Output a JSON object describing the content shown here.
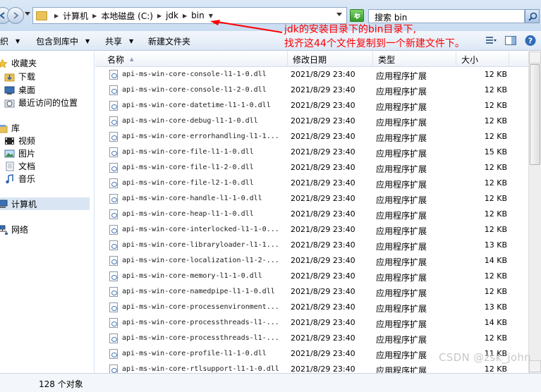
{
  "address_bar": {
    "breadcrumbs": [
      "计算机",
      "本地磁盘 (C:)",
      "jdk",
      "bin"
    ],
    "search_value": "搜索 bin"
  },
  "toolbar": {
    "items": [
      "组织",
      "包含到库中",
      "共享",
      "新建文件夹"
    ]
  },
  "nav": {
    "favorites": "收藏夹",
    "downloads": "下载",
    "desktop": "桌面",
    "recent": "最近访问的位置",
    "libraries": "库",
    "videos": "视频",
    "pictures": "图片",
    "documents": "文档",
    "music": "音乐",
    "computer": "计算机",
    "network": "网络"
  },
  "columns": {
    "name": "名称",
    "date": "修改日期",
    "type": "类型",
    "size": "大小"
  },
  "files": [
    {
      "name": "api-ms-win-core-console-l1-1-0.dll",
      "date": "2021/8/29 23:40",
      "type": "应用程序扩展",
      "size": "12 KB"
    },
    {
      "name": "api-ms-win-core-console-l1-2-0.dll",
      "date": "2021/8/29 23:40",
      "type": "应用程序扩展",
      "size": "12 KB"
    },
    {
      "name": "api-ms-win-core-datetime-l1-1-0.dll",
      "date": "2021/8/29 23:40",
      "type": "应用程序扩展",
      "size": "12 KB"
    },
    {
      "name": "api-ms-win-core-debug-l1-1-0.dll",
      "date": "2021/8/29 23:40",
      "type": "应用程序扩展",
      "size": "12 KB"
    },
    {
      "name": "api-ms-win-core-errorhandling-l1-1...",
      "date": "2021/8/29 23:40",
      "type": "应用程序扩展",
      "size": "12 KB"
    },
    {
      "name": "api-ms-win-core-file-l1-1-0.dll",
      "date": "2021/8/29 23:40",
      "type": "应用程序扩展",
      "size": "15 KB"
    },
    {
      "name": "api-ms-win-core-file-l1-2-0.dll",
      "date": "2021/8/29 23:40",
      "type": "应用程序扩展",
      "size": "12 KB"
    },
    {
      "name": "api-ms-win-core-file-l2-1-0.dll",
      "date": "2021/8/29 23:40",
      "type": "应用程序扩展",
      "size": "12 KB"
    },
    {
      "name": "api-ms-win-core-handle-l1-1-0.dll",
      "date": "2021/8/29 23:40",
      "type": "应用程序扩展",
      "size": "12 KB"
    },
    {
      "name": "api-ms-win-core-heap-l1-1-0.dll",
      "date": "2021/8/29 23:40",
      "type": "应用程序扩展",
      "size": "12 KB"
    },
    {
      "name": "api-ms-win-core-interlocked-l1-1-0...",
      "date": "2021/8/29 23:40",
      "type": "应用程序扩展",
      "size": "12 KB"
    },
    {
      "name": "api-ms-win-core-libraryloader-l1-1...",
      "date": "2021/8/29 23:40",
      "type": "应用程序扩展",
      "size": "13 KB"
    },
    {
      "name": "api-ms-win-core-localization-l1-2-...",
      "date": "2021/8/29 23:40",
      "type": "应用程序扩展",
      "size": "14 KB"
    },
    {
      "name": "api-ms-win-core-memory-l1-1-0.dll",
      "date": "2021/8/29 23:40",
      "type": "应用程序扩展",
      "size": "12 KB"
    },
    {
      "name": "api-ms-win-core-namedpipe-l1-1-0.dll",
      "date": "2021/8/29 23:40",
      "type": "应用程序扩展",
      "size": "12 KB"
    },
    {
      "name": "api-ms-win-core-processenvironment...",
      "date": "2021/8/29 23:40",
      "type": "应用程序扩展",
      "size": "13 KB"
    },
    {
      "name": "api-ms-win-core-processthreads-l1-...",
      "date": "2021/8/29 23:40",
      "type": "应用程序扩展",
      "size": "14 KB"
    },
    {
      "name": "api-ms-win-core-processthreads-l1-...",
      "date": "2021/8/29 23:40",
      "type": "应用程序扩展",
      "size": "12 KB"
    },
    {
      "name": "api-ms-win-core-profile-l1-1-0.dll",
      "date": "2021/8/29 23:40",
      "type": "应用程序扩展",
      "size": "11 KB"
    },
    {
      "name": "api-ms-win-core-rtlsupport-l1-1-0.dll",
      "date": "2021/8/29 23:40",
      "type": "应用程序扩展",
      "size": "12 KB"
    }
  ],
  "status": {
    "count": "128 个对象"
  },
  "annotation": {
    "line1": "jdk的安装目录下的bin目录下,",
    "line2": "找齐这44个文件复制到一个新建文件下。",
    "color": "#ff0000"
  },
  "watermark": "CSDN @zsk_john"
}
